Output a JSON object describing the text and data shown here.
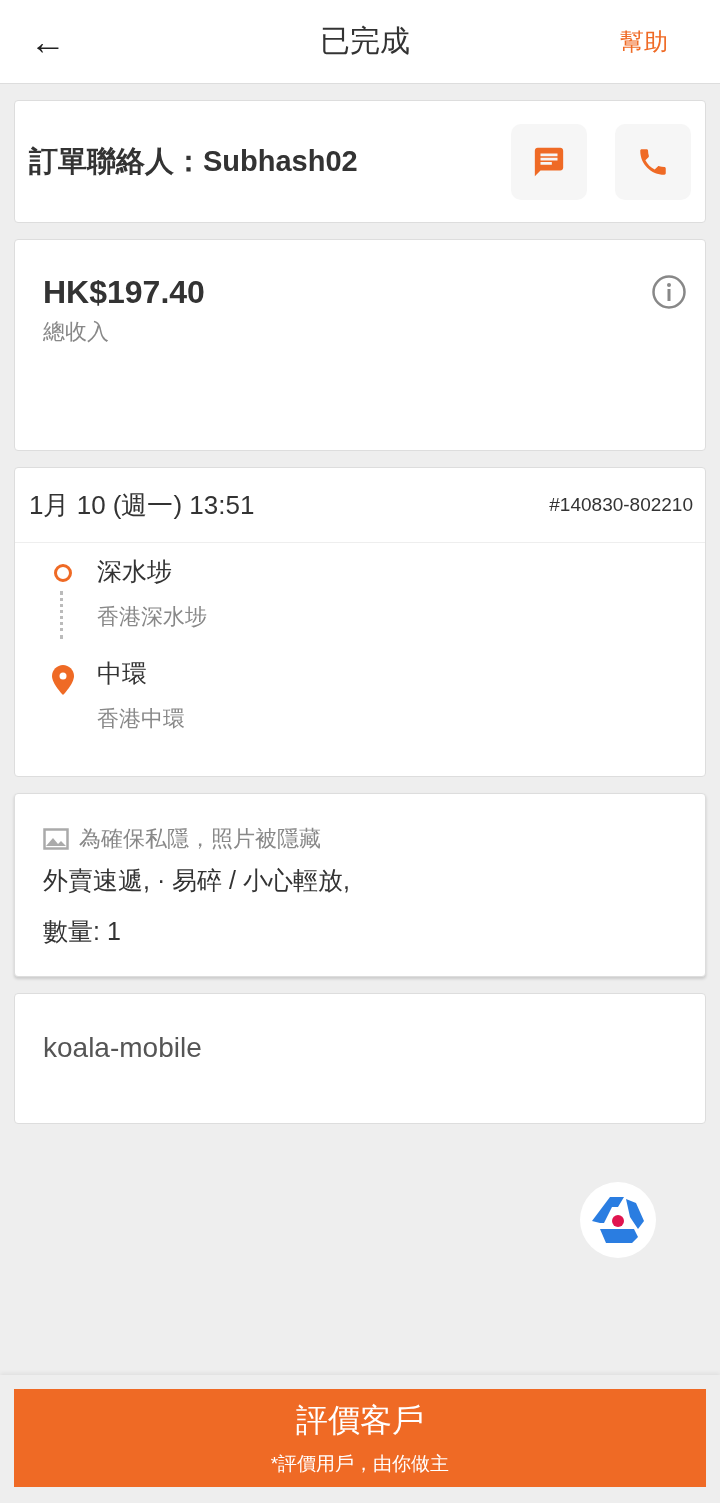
{
  "header": {
    "back": "←",
    "title": "已完成",
    "help": "幫助"
  },
  "contact": {
    "label": "訂單聯絡人：Subhash02"
  },
  "earnings": {
    "amount": "HK$197.40",
    "label": "總收入"
  },
  "order": {
    "datetime": "1月 10 (週一) 13:51",
    "number": "#140830-802210",
    "stops": [
      {
        "kind": "pickup",
        "name": "深水埗",
        "address": "香港深水埗"
      },
      {
        "kind": "dropoff",
        "name": "中環",
        "address": "香港中環"
      }
    ]
  },
  "items": {
    "privacy_note": "為確保私隱，照片被隱藏",
    "description": "外賣速遞, · 易碎 / 小心輕放,",
    "quantity": "數量: 1"
  },
  "note": {
    "text": "koala-mobile"
  },
  "rate_button": {
    "title": "評價客戶",
    "subtitle": "*評價用戶，由你做主"
  }
}
